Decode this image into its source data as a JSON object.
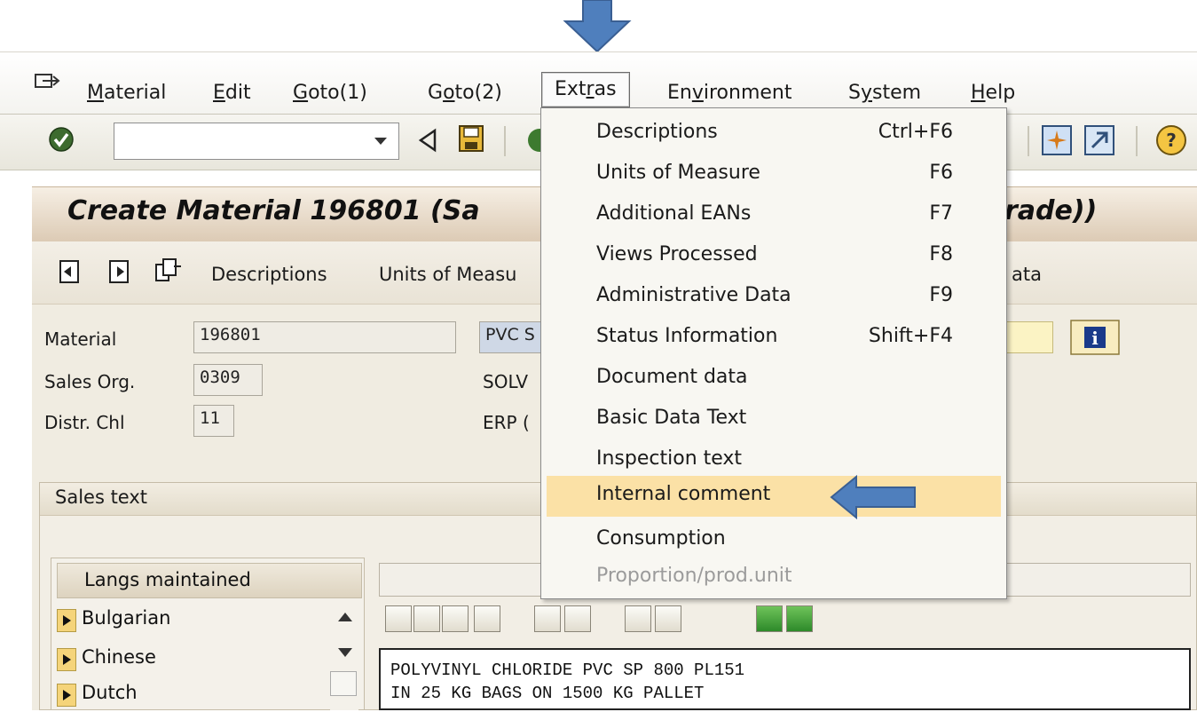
{
  "menubar": {
    "items": [
      {
        "pre": "",
        "u": "M",
        "post": "aterial"
      },
      {
        "pre": "",
        "u": "E",
        "post": "dit"
      },
      {
        "pre": "",
        "u": "G",
        "post": "oto(1)"
      },
      {
        "pre": "G",
        "u": "o",
        "post": "to(2)"
      },
      {
        "pre": "Ext",
        "u": "r",
        "post": "as"
      },
      {
        "pre": "En",
        "u": "v",
        "post": "ironment"
      },
      {
        "pre": "S",
        "u": "y",
        "post": "stem"
      },
      {
        "pre": "",
        "u": "H",
        "post": "elp"
      }
    ]
  },
  "toolbar": {
    "command_field_value": ""
  },
  "page": {
    "title": "Create Material 196801 (Sa",
    "title_tail": "rade))",
    "app_buttons": {
      "descriptions": "Descriptions",
      "units": "Units of Measu",
      "data_tail": "ata"
    }
  },
  "fields": {
    "material_label": "Material",
    "material_value": "196801",
    "material_desc": "PVC S",
    "sales_org_label": "Sales Org.",
    "sales_org_value": "0309",
    "sales_org_desc": "SOLV",
    "distr_chl_label": "Distr. Chl",
    "distr_chl_value": "11",
    "distr_chl_desc": "ERP ("
  },
  "sales_text": {
    "group_title": "Sales text",
    "langs_header": "Langs maintained",
    "languages": [
      "Bulgarian",
      "Chinese",
      "Dutch"
    ],
    "editor_lines": [
      "POLYVINYL CHLORIDE PVC SP 800 PL151",
      "IN 25 KG BAGS ON 1500 KG PALLET"
    ]
  },
  "extras_menu": {
    "items": [
      {
        "label": "Descriptions",
        "shortcut": "Ctrl+F6"
      },
      {
        "label": "Units of Measure",
        "shortcut": "F6"
      },
      {
        "label": "Additional EANs",
        "shortcut": "F7"
      },
      {
        "label": "Views Processed",
        "shortcut": "F8"
      },
      {
        "label": "Administrative Data",
        "shortcut": "F9"
      },
      {
        "label": "Status Information",
        "shortcut": "Shift+F4"
      },
      {
        "label": "Document data",
        "shortcut": ""
      },
      {
        "label": "Basic Data Text",
        "shortcut": ""
      },
      {
        "label": "Inspection text",
        "shortcut": ""
      },
      {
        "label": "Internal comment",
        "shortcut": "",
        "highlighted": true
      },
      {
        "label": "Consumption",
        "shortcut": ""
      },
      {
        "label": "Proportion/prod.unit",
        "shortcut": "",
        "disabled": true
      }
    ]
  },
  "colors": {
    "callout_arrow": "#4f7fbd",
    "highlight": "#fbe1a6",
    "title_bg": "#dccab4"
  }
}
